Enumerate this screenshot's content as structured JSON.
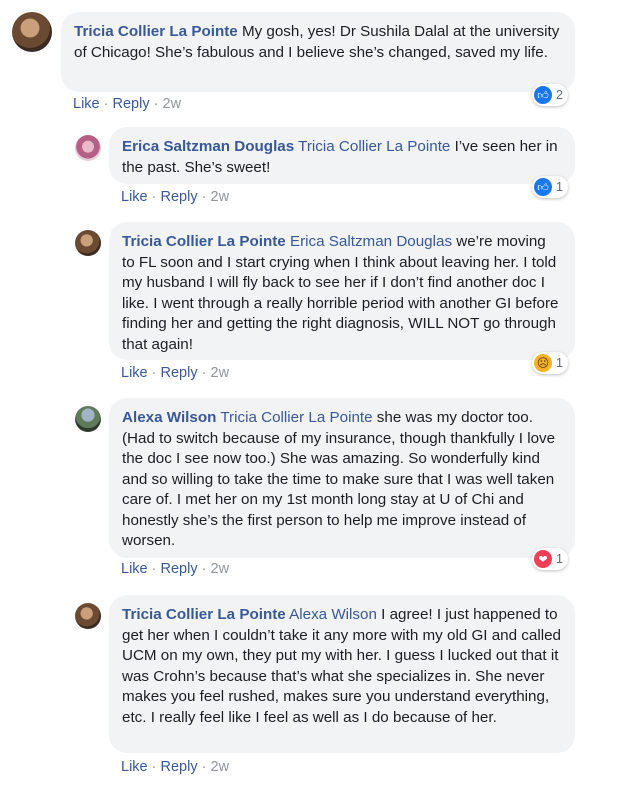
{
  "comments": [
    {
      "author": "Tricia Collier La Pointe",
      "mention": "",
      "text": " My gosh, yes! Dr Sushila Dalal at the university of Chicago! She’s fabulous and I believe she’s changed, saved my life.",
      "like_label": "Like",
      "reply_label": "Reply",
      "time": "2w",
      "reaction": {
        "type": "like",
        "icon": "like-icon",
        "count": "2"
      }
    },
    {
      "author": "Erica Saltzman Douglas",
      "mention": "Tricia Collier La Pointe",
      "text": " I’ve seen her in the past. She’s sweet!",
      "like_label": "Like",
      "reply_label": "Reply",
      "time": "2w",
      "reaction": {
        "type": "like",
        "icon": "like-icon",
        "count": "1"
      }
    },
    {
      "author": "Tricia Collier La Pointe",
      "mention": "Erica Saltzman Douglas",
      "text": " we’re moving to FL soon and I start crying when I think about leaving her. I told my husband I will fly back to see her if I don’t find another doc I like. I went through a really horrible period with another GI before finding her and getting the right diagnosis, WILL NOT go through that again!",
      "like_label": "Like",
      "reply_label": "Reply",
      "time": "2w",
      "reaction": {
        "type": "sad",
        "icon": "sad-icon",
        "count": "1"
      }
    },
    {
      "author": "Alexa Wilson",
      "mention": "Tricia Collier La Pointe",
      "text": " she was my doctor too. (Had to switch because of my insurance, though thankfully I love the doc I see now too.) She was amazing. So wonderfully kind and so willing to take the time to make sure that I was well taken care of. I met her on my 1st month long stay at U of Chi and honestly she’s the first person to help me improve instead of worsen.",
      "like_label": "Like",
      "reply_label": "Reply",
      "time": "2w",
      "reaction": {
        "type": "love",
        "icon": "heart-icon",
        "count": "1"
      }
    },
    {
      "author": "Tricia Collier La Pointe",
      "mention": "Alexa Wilson",
      "text": " I agree! I just happened to get her when I couldn’t take it any more with my old GI and called UCM on my own, they put my with her. I guess I lucked out that it was Crohn’s because that’s what she specializes in. She never makes you feel rushed, makes sure you understand everything, etc. I really feel like I feel as well as I do because of her.",
      "like_label": "Like",
      "reply_label": "Reply",
      "time": "2w",
      "reaction": null
    }
  ],
  "colors": {
    "link": "#385898",
    "bubble": "#f2f3f5",
    "like": "#1877f2",
    "love": "#f33e58",
    "sad": "#f7b125"
  }
}
